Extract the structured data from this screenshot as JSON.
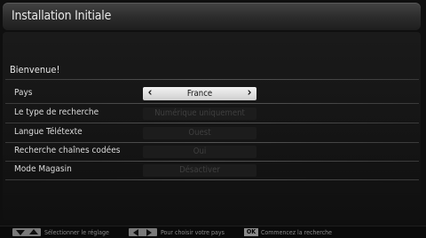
{
  "header": {
    "title": "Installation Initiale"
  },
  "welcome": "Bienvenue!",
  "settings": [
    {
      "label": "Pays",
      "value": "France"
    },
    {
      "label": "Le type de recherche",
      "value": "Numérique uniquement"
    },
    {
      "label": "Langue Télétexte",
      "value": "Ouest"
    },
    {
      "label": "Recherche chaînes codées",
      "value": "Oui"
    },
    {
      "label": "Mode Magasin",
      "value": "Désactiver"
    }
  ],
  "footer": {
    "hint_select": "Sélectionner le réglage",
    "hint_country": "Pour choisir votre pays",
    "ok_key": "OK",
    "hint_ok": "Commencez la recherche"
  },
  "icons": {
    "up_down": "up-down-arrows-icon",
    "left_right": "left-right-arrows-icon",
    "ok": "ok-key-icon"
  },
  "colors": {
    "active_bg": "#e6e6e6",
    "background": "#0f0f0f"
  }
}
